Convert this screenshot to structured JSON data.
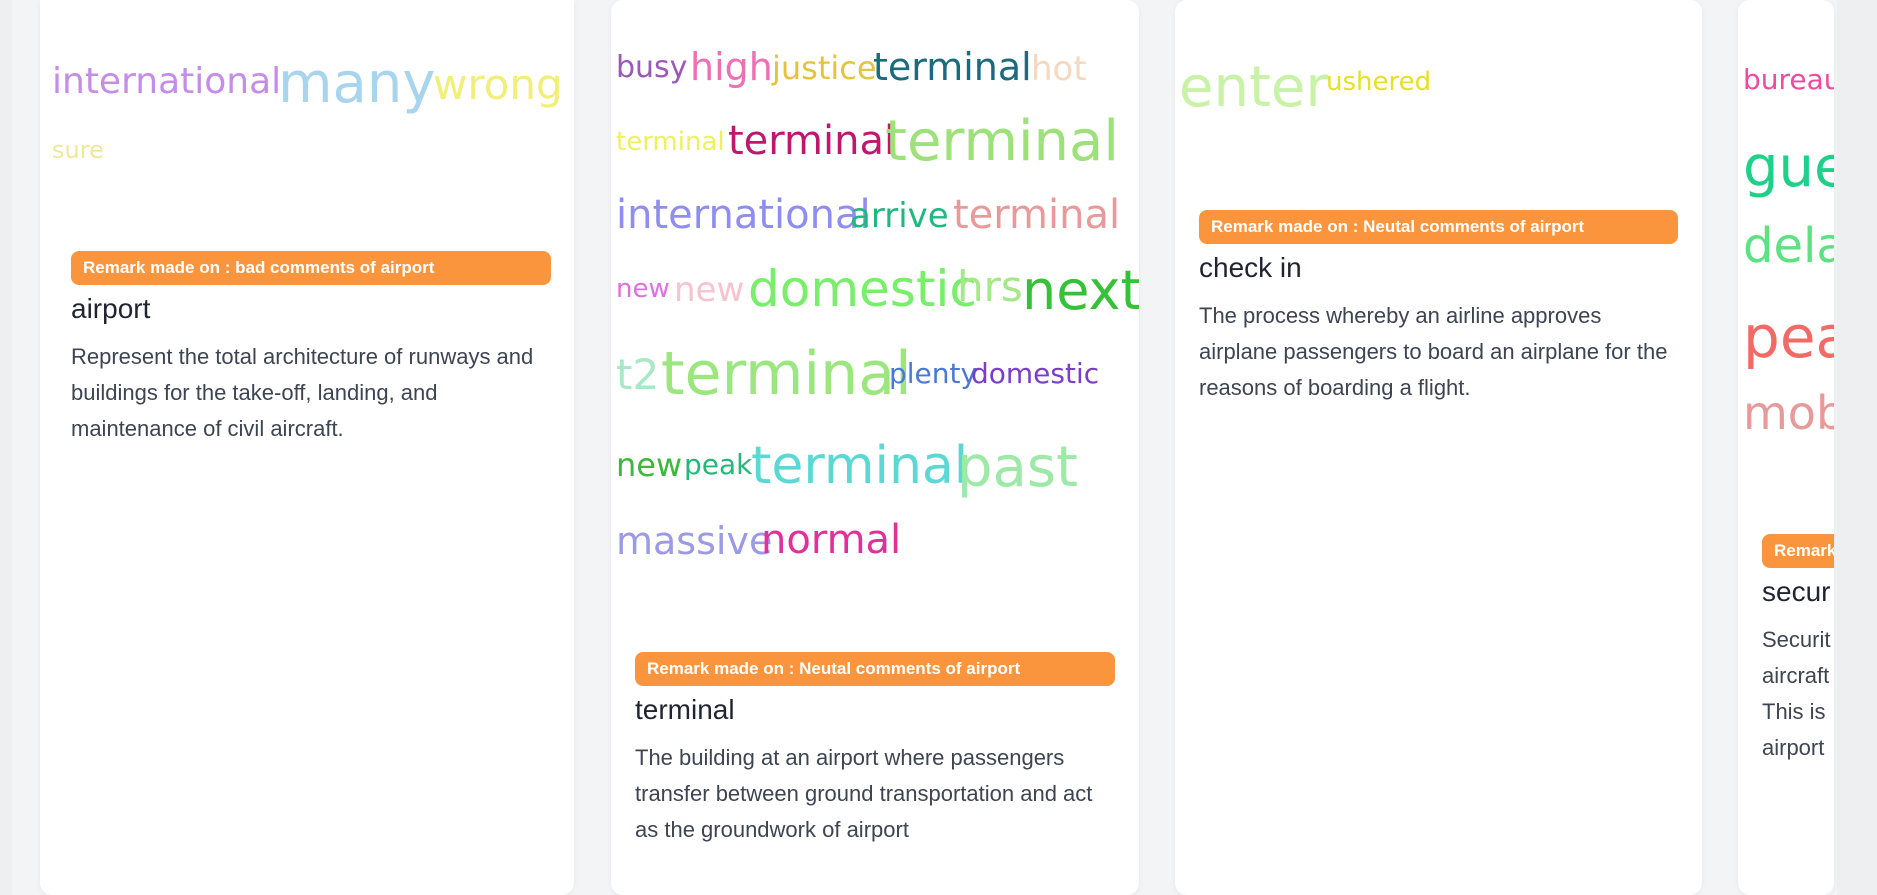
{
  "cards": [
    {
      "cloud": [
        {
          "text": "international",
          "color": "#c58ce8"
        },
        {
          "text": "many",
          "color": "#a8d4ee"
        },
        {
          "text": "wrong",
          "color": "#f2ef78"
        },
        {
          "text": "sure",
          "color": "#f0e79a"
        }
      ],
      "badge": "Remark made on : bad comments of airport",
      "term": "airport",
      "description": "Represent the total architecture of runways and buildings for the take-off, landing, and maintenance of civil aircraft."
    },
    {
      "cloud": [
        {
          "text": "busy",
          "color": "#9b59b6"
        },
        {
          "text": "high",
          "color": "#f06fb4"
        },
        {
          "text": "justice",
          "color": "#e6c33c"
        },
        {
          "text": "terminal",
          "color": "#1a6a80"
        },
        {
          "text": "hot",
          "color": "#f5d8c0"
        },
        {
          "text": "terminal",
          "color": "#eef060"
        },
        {
          "text": "terminal",
          "color": "#c0176e"
        },
        {
          "text": "terminal",
          "color": "#9ee07a"
        },
        {
          "text": "international",
          "color": "#8f8ef0"
        },
        {
          "text": "arrive",
          "color": "#20b880"
        },
        {
          "text": "terminal",
          "color": "#e89a9a"
        },
        {
          "text": "new",
          "color": "#e070e0"
        },
        {
          "text": "new",
          "color": "#f6c4cf"
        },
        {
          "text": "domestic",
          "color": "#78ee6a"
        },
        {
          "text": "hrs",
          "color": "#a4e88a"
        },
        {
          "text": "next",
          "color": "#36c238"
        },
        {
          "text": "t2",
          "color": "#a8e8c4"
        },
        {
          "text": "terminal",
          "color": "#9be67e"
        },
        {
          "text": "plenty",
          "color": "#4a78d6"
        },
        {
          "text": "domestic",
          "color": "#7a3ec8"
        },
        {
          "text": "new",
          "color": "#3cb83c"
        },
        {
          "text": "peak",
          "color": "#22b87a"
        },
        {
          "text": "terminal",
          "color": "#5cd8d4"
        },
        {
          "text": "past",
          "color": "#9ee8a8"
        },
        {
          "text": "massive",
          "color": "#9a9ae6"
        },
        {
          "text": "normal",
          "color": "#e0309a"
        }
      ],
      "badge": "Remark made on : Neutal comments of airport",
      "term": "terminal",
      "description": "The building at an airport where passengers transfer between ground transportation and act as the groundwork of airport"
    },
    {
      "cloud": [
        {
          "text": "enter",
          "color": "#c8f2a6"
        },
        {
          "text": "ushered",
          "color": "#e6e028"
        }
      ],
      "badge": "Remark made on : Neutal comments of airport",
      "term": "check in",
      "description": "The process whereby an airline approves airplane passengers to board an airplane for the reasons of boarding a flight."
    },
    {
      "cloud": [
        {
          "text": "bureau",
          "color": "#ee4aa0"
        },
        {
          "text": "gue",
          "color": "#1ed08a"
        },
        {
          "text": "dela",
          "color": "#5ce282"
        },
        {
          "text": "pea",
          "color": "#f06a66"
        },
        {
          "text": "mob",
          "color": "#e89a9a"
        }
      ],
      "badge": "Remark",
      "term": "secur",
      "description": "Securit aircraft This is airport"
    }
  ]
}
